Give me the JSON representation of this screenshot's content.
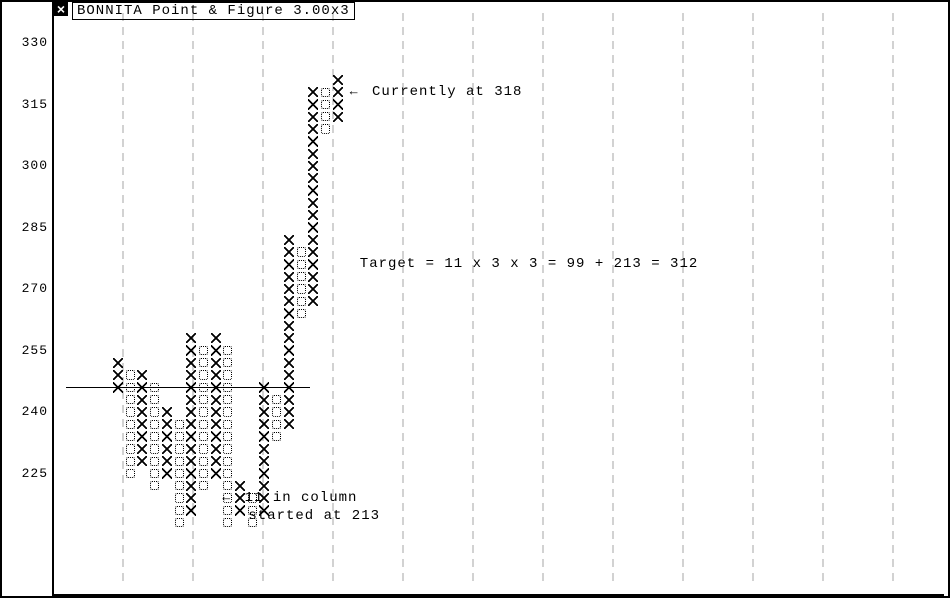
{
  "title": "BONNITA Point & Figure 3.00x3",
  "y_ticks": [
    330,
    315,
    300,
    285,
    270,
    255,
    240,
    225
  ],
  "annotations": {
    "current": "Currently at 318",
    "target": "Target = 11 x 3 x 3 = 99 + 213 = 312",
    "column": "11 in column",
    "column2": "started at 213"
  },
  "chart_data": {
    "type": "point-and-figure",
    "title": "BONNITA Point & Figure 3.00x3",
    "ylabel": "",
    "xlabel": "",
    "ylim": [
      213,
      335
    ],
    "box_size": 3.0,
    "reversal": 3,
    "current_price": 318,
    "target_calc": {
      "columns": 11,
      "box": 3,
      "reversal": 3,
      "product": 99,
      "base": 213,
      "target": 312
    },
    "columns": [
      {
        "type": "X",
        "low": 246,
        "high": 252
      },
      {
        "type": "O",
        "low": 225,
        "high": 249
      },
      {
        "type": "X",
        "low": 228,
        "high": 249
      },
      {
        "type": "O",
        "low": 222,
        "high": 246
      },
      {
        "type": "X",
        "low": 225,
        "high": 240
      },
      {
        "type": "O",
        "low": 213,
        "high": 237
      },
      {
        "type": "X",
        "low": 216,
        "high": 258
      },
      {
        "type": "O",
        "low": 222,
        "high": 255
      },
      {
        "type": "X",
        "low": 225,
        "high": 258
      },
      {
        "type": "O",
        "low": 213,
        "high": 255
      },
      {
        "type": "X",
        "low": 216,
        "high": 222
      },
      {
        "type": "O",
        "low": 213,
        "high": 219
      },
      {
        "type": "X",
        "low": 216,
        "high": 246
      },
      {
        "type": "O",
        "low": 234,
        "high": 243
      },
      {
        "type": "X",
        "low": 237,
        "high": 282
      },
      {
        "type": "O",
        "low": 264,
        "high": 279
      },
      {
        "type": "X",
        "low": 267,
        "high": 318
      },
      {
        "type": "O",
        "low": 309,
        "high": 318
      },
      {
        "type": "X",
        "low": 312,
        "high": 321
      }
    ],
    "horizontal_line_at": 246
  }
}
